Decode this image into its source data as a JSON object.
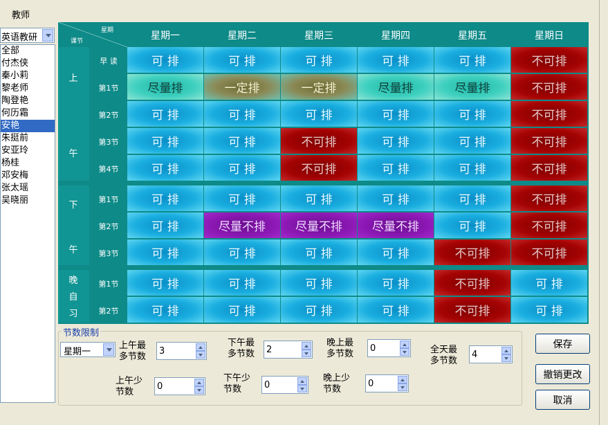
{
  "window": {
    "label": "教师"
  },
  "teacher_panel": {
    "group_select": "英语教研",
    "teachers": [
      "全部",
      "付杰侠",
      "秦小莉",
      "黎老师",
      "陶登艳",
      "何历霜",
      "安艳",
      "朱挺前",
      "安亚玲",
      "杨桂",
      "邓安梅",
      "张太瑶",
      "吴晓丽"
    ],
    "selected_index": 6
  },
  "timetable": {
    "corner_top": "星期",
    "corner_bottom": "课节",
    "days": [
      "星期一",
      "星期二",
      "星期三",
      "星期四",
      "星期五",
      "星期日"
    ],
    "sections": [
      {
        "chars": [
          "上",
          "午"
        ],
        "periods": [
          "早 读",
          "第1节",
          "第2节",
          "第3节",
          "第4节"
        ]
      },
      {
        "chars": [
          "下",
          "午"
        ],
        "periods": [
          "第1节",
          "第2节",
          "第3节"
        ]
      },
      {
        "chars": [
          "晚",
          "自",
          "习"
        ],
        "periods": [
          "第1节",
          "第2节"
        ]
      }
    ],
    "rows": [
      [
        "可 排",
        "可 排",
        "可 排",
        "可 排",
        "可 排",
        "不可排"
      ],
      [
        "尽量排",
        "一定排",
        "一定排",
        "尽量排",
        "尽量排",
        "不可排"
      ],
      [
        "可 排",
        "可 排",
        "可 排",
        "可 排",
        "可 排",
        "不可排"
      ],
      [
        "可 排",
        "可 排",
        "不可排",
        "可 排",
        "可 排",
        "不可排"
      ],
      [
        "可 排",
        "可 排",
        "不可排",
        "可 排",
        "可 排",
        "不可排"
      ],
      [
        "可 排",
        "可 排",
        "可 排",
        "可 排",
        "可 排",
        "不可排"
      ],
      [
        "可 排",
        "尽量不排",
        "尽量不排",
        "尽量不排",
        "可 排",
        "不可排"
      ],
      [
        "可 排",
        "可 排",
        "可 排",
        "可 排",
        "不可排",
        "不可排"
      ],
      [
        "可 排",
        "可 排",
        "可 排",
        "可 排",
        "不可排",
        "可 排"
      ],
      [
        "可 排",
        "可 排",
        "可 排",
        "可 排",
        "不可排",
        "可 排"
      ]
    ],
    "colors": {
      "可 排": "#1aaee0",
      "不可排": "#a50303",
      "尽量排": "#3fd0bf",
      "一定排": "#8b8a56",
      "尽量不排": "#8c18b4"
    }
  },
  "limits": {
    "legend": "节数限制",
    "day_select": "星期一",
    "fields": [
      {
        "key": "am_max",
        "label": [
          "上午最",
          "多节数"
        ],
        "value": "3"
      },
      {
        "key": "pm_max",
        "label": [
          "下午最",
          "多节数"
        ],
        "value": "2"
      },
      {
        "key": "eve_max",
        "label": [
          "晚上最",
          "多节数"
        ],
        "value": "0"
      },
      {
        "key": "day_max",
        "label": [
          "全天最",
          "多节数"
        ],
        "value": "4"
      },
      {
        "key": "am_min",
        "label": [
          "上午少",
          "节数"
        ],
        "value": "0"
      },
      {
        "key": "pm_min",
        "label": [
          "下午少",
          "节数"
        ],
        "value": "0"
      },
      {
        "key": "eve_min",
        "label": [
          "晚上少",
          "节数"
        ],
        "value": "0"
      }
    ]
  },
  "buttons": {
    "save": "保存",
    "undo": "撤销更改",
    "cancel": "取消"
  }
}
